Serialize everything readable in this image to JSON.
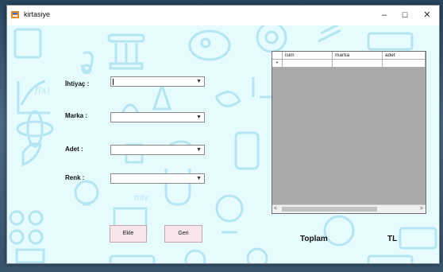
{
  "window": {
    "title": "kirtasiye",
    "minimize": "–",
    "maximize": "☐",
    "close": "✕"
  },
  "form": {
    "ihtiyac_label": "İhtiyaç :",
    "marka_label": "Marka :",
    "adet_label": "Adet :",
    "renk_label": "Renk :",
    "ihtiyac_value": "",
    "marka_value": "",
    "adet_value": "",
    "renk_value": ""
  },
  "buttons": {
    "ekle": "Ekle",
    "geri": "Geri"
  },
  "grid": {
    "columns": [
      "isim",
      "marka",
      "adet"
    ],
    "new_row_marker": "*",
    "scroll_left": "<",
    "scroll_right": ">"
  },
  "totals": {
    "toplam_label": "Toplam",
    "currency": "TL"
  },
  "colors": {
    "client_bg": "#e6fbfe",
    "icon_tint": "#b7e6f2",
    "button_bg": "#f8e6ea"
  }
}
